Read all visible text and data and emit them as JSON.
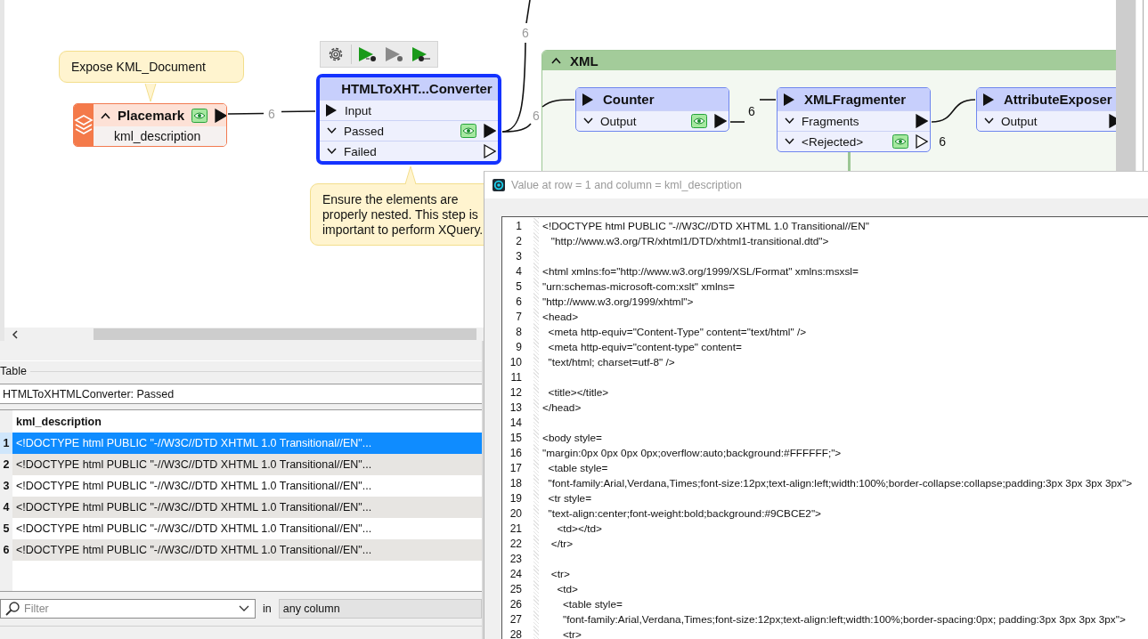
{
  "canvas": {
    "annotations": [
      {
        "text": "Expose KML_Document"
      },
      {
        "text": "Ensure the elements are properly nested. This step is important to perform XQuery."
      }
    ],
    "bookmark": {
      "title": "XML",
      "expanded": true
    },
    "nodes": [
      {
        "kind": "reader",
        "title": "Placemark",
        "selected": false,
        "expanded": true,
        "inspected": true,
        "connected": true,
        "attributes": [
          "kml_description"
        ]
      },
      {
        "kind": "transformer",
        "title": "HTMLToXHT...Converter",
        "selected": true,
        "header_input": false,
        "ports": [
          {
            "kind": "input",
            "name": "Input"
          },
          {
            "kind": "output",
            "name": "Passed",
            "inspected": true,
            "connected": true
          },
          {
            "kind": "output",
            "name": "Failed",
            "inspected": false,
            "connected": false
          }
        ]
      },
      {
        "kind": "transformer",
        "title": "Counter",
        "selected": false,
        "header_input": true,
        "ports": [
          {
            "kind": "output",
            "name": "Output",
            "inspected": true,
            "connected": true
          }
        ]
      },
      {
        "kind": "transformer",
        "title": "XMLFragmenter",
        "selected": false,
        "header_input": true,
        "ports": [
          {
            "kind": "output",
            "name": "Fragments",
            "inspected": false,
            "connected": true
          },
          {
            "kind": "output",
            "name": "<Rejected>",
            "inspected": true,
            "connected": false,
            "count": "6"
          }
        ]
      },
      {
        "kind": "transformer",
        "title": "AttributeExposer",
        "selected": false,
        "header_input": true,
        "ports": [
          {
            "kind": "output",
            "name": "Output",
            "inspected": false,
            "connected": true
          }
        ]
      }
    ],
    "connections": [
      {
        "count": "6"
      },
      {
        "count": "6"
      },
      {
        "count": "6"
      },
      {
        "count": "6"
      }
    ]
  },
  "table_panel": {
    "title": "Table",
    "source": "HTMLToXHTMLConverter: Passed",
    "column": "kml_description",
    "rows": [
      {
        "number": "1",
        "value": "<!DOCTYPE html PUBLIC \"-//W3C//DTD XHTML 1.0 Transitional//EN\"...",
        "selected": true
      },
      {
        "number": "2",
        "value": "<!DOCTYPE html PUBLIC \"-//W3C//DTD XHTML 1.0 Transitional//EN\"...",
        "selected": false
      },
      {
        "number": "3",
        "value": "<!DOCTYPE html PUBLIC \"-//W3C//DTD XHTML 1.0 Transitional//EN\"...",
        "selected": false
      },
      {
        "number": "4",
        "value": "<!DOCTYPE html PUBLIC \"-//W3C//DTD XHTML 1.0 Transitional//EN\"...",
        "selected": false
      },
      {
        "number": "5",
        "value": "<!DOCTYPE html PUBLIC \"-//W3C//DTD XHTML 1.0 Transitional//EN\"...",
        "selected": false
      },
      {
        "number": "6",
        "value": "<!DOCTYPE html PUBLIC \"-//W3C//DTD XHTML 1.0 Transitional//EN\"...",
        "selected": false
      }
    ],
    "filter": {
      "placeholder": "Filter",
      "in_label": "in",
      "scope": "any column"
    }
  },
  "value_dialog": {
    "title": "Value at row = 1 and column = kml_description",
    "lines": [
      {
        "number": "1",
        "text": "<!DOCTYPE html PUBLIC \"-//W3C//DTD XHTML 1.0 Transitional//EN\""
      },
      {
        "number": "2",
        "text": "   \"http://www.w3.org/TR/xhtml1/DTD/xhtml1-transitional.dtd\">"
      },
      {
        "number": "3"
      },
      {
        "number": "4",
        "text": "<html xmlns:fo=\"http://www.w3.org/1999/XSL/Format\" xmlns:msxsl="
      },
      {
        "number": "5",
        "text": "\"urn:schemas-microsoft-com:xslt\" xmlns="
      },
      {
        "number": "6",
        "text": "\"http://www.w3.org/1999/xhtml\">"
      },
      {
        "number": "7",
        "text": "<head>"
      },
      {
        "number": "8",
        "text": "  <meta http-equiv=\"Content-Type\" content=\"text/html\" />"
      },
      {
        "number": "9",
        "text": "  <meta http-equiv=\"content-type\" content="
      },
      {
        "number": "10",
        "text": "  \"text/html; charset=utf-8\" />"
      },
      {
        "number": "11"
      },
      {
        "number": "12",
        "text": "  <title></title>"
      },
      {
        "number": "13",
        "text": "</head>"
      },
      {
        "number": "14"
      },
      {
        "number": "15",
        "text": "<body style="
      },
      {
        "number": "16",
        "text": "\"margin:0px 0px 0px 0px;overflow:auto;background:#FFFFFF;\">"
      },
      {
        "number": "17",
        "text": "  <table style="
      },
      {
        "number": "18",
        "text": "  \"font-family:Arial,Verdana,Times;font-size:12px;text-align:left;width:100%;border-collapse:collapse;padding:3px 3px 3px 3px\">"
      },
      {
        "number": "19",
        "text": "  <tr style="
      },
      {
        "number": "20",
        "text": "  \"text-align:center;font-weight:bold;background:#9CBCE2\">"
      },
      {
        "number": "21",
        "text": "     <td></td>"
      },
      {
        "number": "22",
        "text": "   </tr>"
      },
      {
        "number": "23"
      },
      {
        "number": "24",
        "text": "   <tr>"
      },
      {
        "number": "25",
        "text": "     <td>"
      },
      {
        "number": "26",
        "text": "       <table style="
      },
      {
        "number": "27",
        "text": "       \"font-family:Arial,Verdana,Times;font-size:12px;text-align:left;width:100%;border-spacing:0px; padding:3px 3px 3px 3px\">"
      },
      {
        "number": "28",
        "text": "       <tr>"
      }
    ]
  }
}
